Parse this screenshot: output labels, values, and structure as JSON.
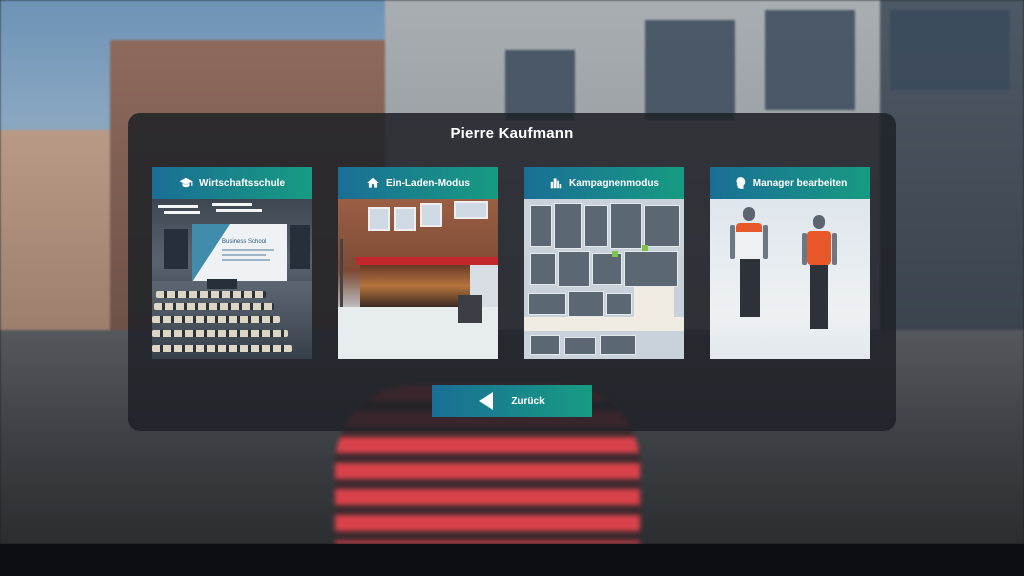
{
  "menu": {
    "title": "Pierre Kaufmann",
    "cards": [
      {
        "label": "Wirtschaftsschule",
        "icon": "graduation-cap-icon",
        "preview": "lecture-hall",
        "screen_title": "Business School",
        "screen_subtitle": "Welcome to BPC Live"
      },
      {
        "label": "Ein-Laden-Modus",
        "icon": "home-icon",
        "preview": "storefront"
      },
      {
        "label": "Kampagnenmodus",
        "icon": "city-icon",
        "preview": "office-map"
      },
      {
        "label": "Manager bearbeiten",
        "icon": "head-profile-icon",
        "preview": "managers"
      }
    ],
    "back_label": "Zurück"
  },
  "colors": {
    "button_gradient_start": "#1a6e96",
    "button_gradient_end": "#179b82",
    "panel_bg": "#1e2228",
    "shirt_orange": "#e8572a"
  }
}
